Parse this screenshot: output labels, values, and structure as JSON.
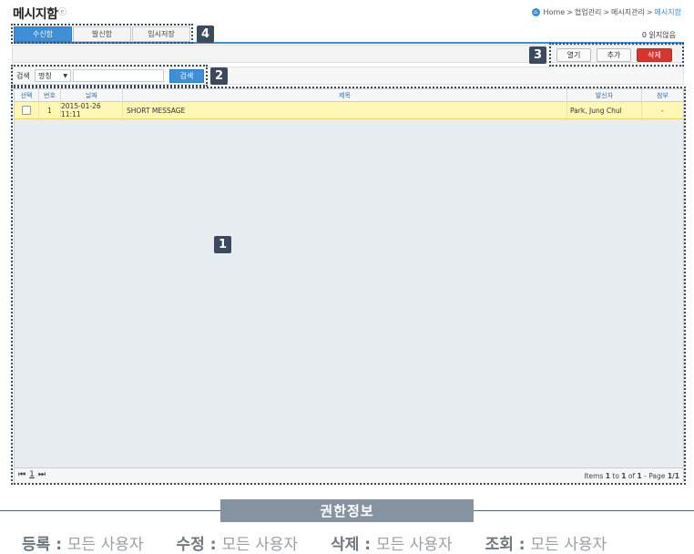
{
  "page": {
    "title": "메시지함",
    "help_icon": "help-icon"
  },
  "breadcrumb": {
    "home": "Home",
    "sep": ">",
    "items": [
      "협업관리",
      "메시지관리"
    ],
    "current": "메시지함"
  },
  "tabs": [
    {
      "label": "수신함",
      "active": true
    },
    {
      "label": "발신함",
      "active": false
    },
    {
      "label": "임시저장",
      "active": false
    }
  ],
  "unread": {
    "count": "0",
    "label": "읽지않음"
  },
  "toolbar": {
    "open_label": "열기",
    "add_label": "추가",
    "delete_label": "삭제"
  },
  "search": {
    "label": "검색",
    "field": "명칭",
    "value": "",
    "button_label": "검색"
  },
  "grid": {
    "columns": [
      "선택",
      "번호",
      "날짜",
      "제목",
      "발신자",
      "첨부"
    ],
    "rows": [
      {
        "checked": false,
        "no": "1",
        "date": "2015-01-26 11:11",
        "subject": "SHORT MESSAGE",
        "sender": "Park, Jung Chul",
        "attach": "-"
      }
    ]
  },
  "pager": {
    "first": "⏮",
    "page": "1",
    "last": "⏭",
    "items_prefix": "Items",
    "from": "1",
    "to_label": "to",
    "to": "1",
    "of_label": "of",
    "total": "1",
    "page_label": "Page",
    "page_of": "1/1"
  },
  "callouts": [
    "1",
    "2",
    "3",
    "4"
  ],
  "permissions": {
    "title": "권한정보",
    "items": [
      {
        "key": "등록",
        "value": "모든 사용자"
      },
      {
        "key": "수정",
        "value": "모든 사용자"
      },
      {
        "key": "삭제",
        "value": "모든 사용자"
      },
      {
        "key": "조회",
        "value": "모든 사용자"
      }
    ]
  },
  "colors": {
    "accent": "#3f8fd8",
    "danger": "#d9342b",
    "row_highlight": "#fff7b3",
    "callout": "#3c4a5e",
    "permission_bar": "#8593a0"
  }
}
